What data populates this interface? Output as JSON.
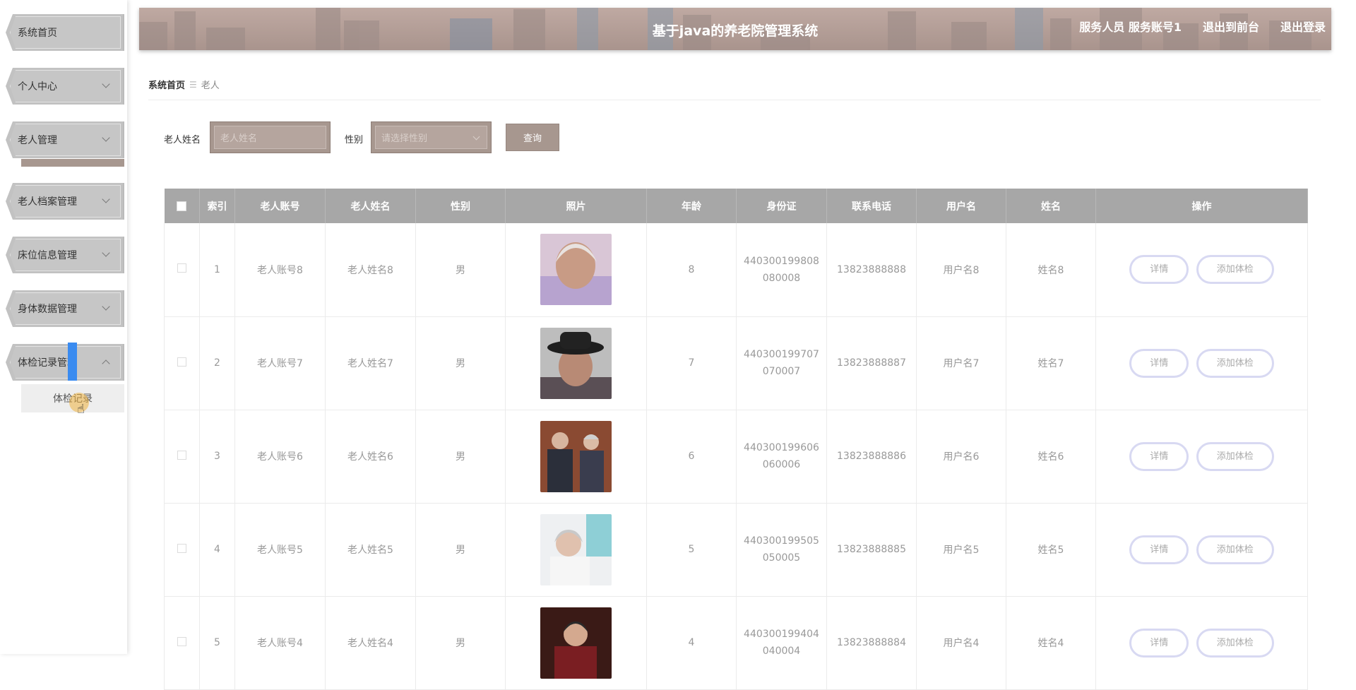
{
  "sidebar": {
    "items": [
      {
        "label": "系统首页",
        "has_arrow": false
      },
      {
        "label": "个人中心",
        "has_arrow": true
      },
      {
        "label": "老人管理",
        "has_arrow": true
      },
      {
        "label": "老人档案管理",
        "has_arrow": true
      },
      {
        "label": "床位信息管理",
        "has_arrow": true
      },
      {
        "label": "身体数据管理",
        "has_arrow": true
      },
      {
        "label": "体检记录管理",
        "has_arrow": true,
        "expanded": true
      }
    ],
    "submenu": {
      "label": "体检记录"
    }
  },
  "header": {
    "title": "基于java的养老院管理系统",
    "user": "服务人员 服务账号1",
    "front_link": "退出到前台",
    "logout": "退出登录"
  },
  "breadcrumb": {
    "home": "系统首页",
    "separator": "☰",
    "current": "老人"
  },
  "search": {
    "name_label": "老人姓名",
    "name_placeholder": "老人姓名",
    "gender_label": "性别",
    "gender_placeholder": "请选择性别",
    "query_button": "查询"
  },
  "table": {
    "columns": [
      "索引",
      "老人账号",
      "老人姓名",
      "性别",
      "照片",
      "年龄",
      "身份证",
      "联系电话",
      "用户名",
      "姓名",
      "操作"
    ],
    "rows": [
      {
        "index": "1",
        "account": "老人账号8",
        "name": "老人姓名8",
        "gender": "男",
        "age": "8",
        "id_line1": "440300199808",
        "id_line2": "080008",
        "phone": "13823888888",
        "username": "用户名8",
        "realname": "姓名8"
      },
      {
        "index": "2",
        "account": "老人账号7",
        "name": "老人姓名7",
        "gender": "男",
        "age": "7",
        "id_line1": "440300199707",
        "id_line2": "070007",
        "phone": "13823888887",
        "username": "用户名7",
        "realname": "姓名7"
      },
      {
        "index": "3",
        "account": "老人账号6",
        "name": "老人姓名6",
        "gender": "男",
        "age": "6",
        "id_line1": "440300199606",
        "id_line2": "060006",
        "phone": "13823888886",
        "username": "用户名6",
        "realname": "姓名6"
      },
      {
        "index": "4",
        "account": "老人账号5",
        "name": "老人姓名5",
        "gender": "男",
        "age": "5",
        "id_line1": "440300199505",
        "id_line2": "050005",
        "phone": "13823888885",
        "username": "用户名5",
        "realname": "姓名5"
      },
      {
        "index": "5",
        "account": "老人账号4",
        "name": "老人姓名4",
        "gender": "男",
        "age": "4",
        "id_line1": "440300199404",
        "id_line2": "040004",
        "phone": "13823888884",
        "username": "用户名4",
        "realname": "姓名4"
      }
    ],
    "detail_button": "详情",
    "add_exam_button": "添加体检"
  },
  "colors": {
    "accent": "#a7978f",
    "header_bg": "#b9a49d",
    "table_header": "#a7a7a7",
    "pill_border": "#d8d9f2",
    "menu_bg": "#c4c4c4",
    "highlight": "#3a8bf0"
  }
}
